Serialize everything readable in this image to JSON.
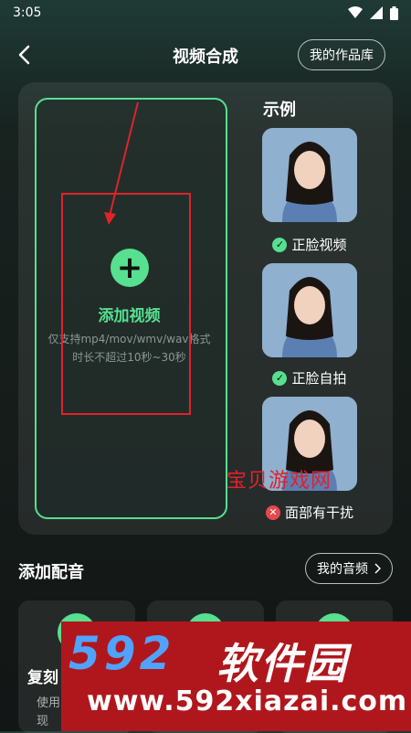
{
  "status": {
    "time": "3:05"
  },
  "header": {
    "title": "视频合成",
    "gallery_label": "我的作品库"
  },
  "upload": {
    "add_label": "添加视频",
    "hint_formats": "仅支持mp4/mov/wmv/wav格式",
    "hint_duration": "时长不超过10秒~30秒"
  },
  "examples": {
    "title": "示例",
    "items": [
      {
        "caption": "正脸视频",
        "status": "ok"
      },
      {
        "caption": "正脸自拍",
        "status": "ok"
      },
      {
        "caption": "面部有干扰",
        "status": "bad"
      }
    ]
  },
  "watermark": {
    "site_text": "宝贝游戏网",
    "banner_number": "592",
    "banner_cn": "软件园",
    "banner_url": "www.592xiazai.com"
  },
  "audio": {
    "title": "添加配音",
    "my_audio_label": "我的音频",
    "cards": [
      {
        "title": "复刻",
        "desc1": "使用",
        "desc2": "现"
      },
      {
        "title": "",
        "desc1": "",
        "desc2": ""
      },
      {
        "title": "",
        "desc1": "",
        "desc2": ""
      }
    ]
  },
  "colors": {
    "accent": "#56e08f",
    "annotation": "#e0222b",
    "background": "#121615"
  }
}
